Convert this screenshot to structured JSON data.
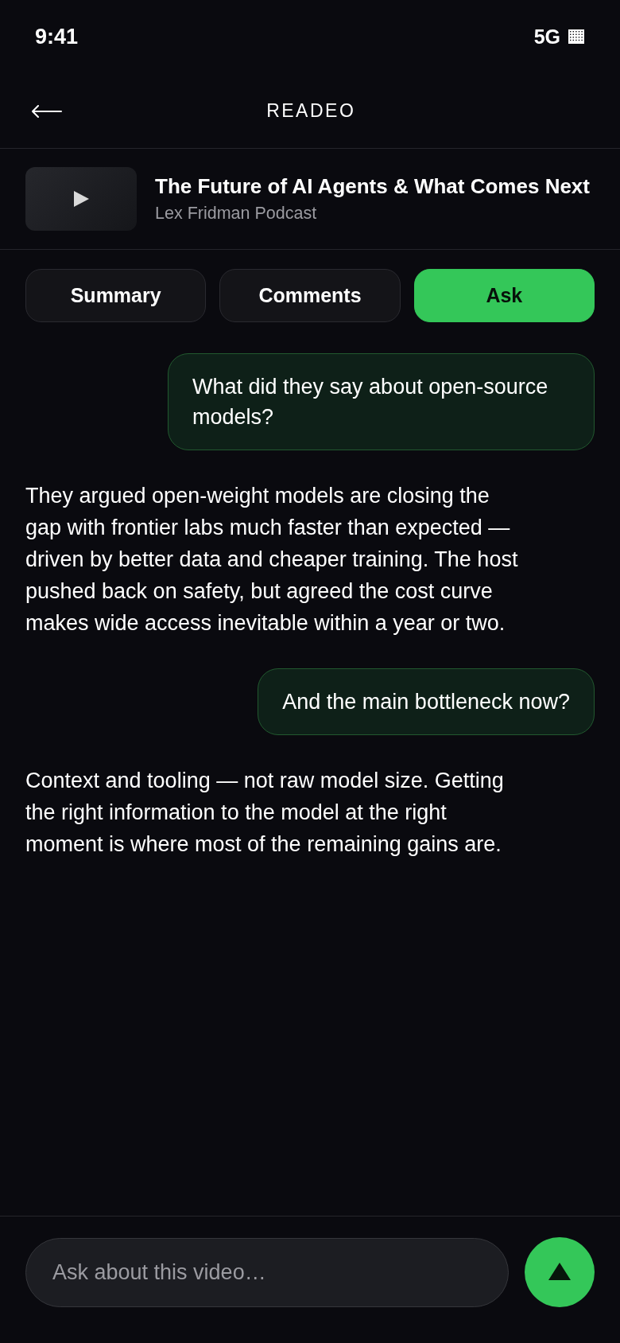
{
  "status_bar": {
    "time": "9:41",
    "network": "5G"
  },
  "header": {
    "title": "READEO"
  },
  "video": {
    "title": "The Future of AI Agents & What Comes Next",
    "channel": "Lex Fridman Podcast"
  },
  "tabs": [
    {
      "label": "Summary",
      "selected": false
    },
    {
      "label": "Comments",
      "selected": false
    },
    {
      "label": "Ask",
      "selected": true
    }
  ],
  "messages": [
    {
      "kind": "question",
      "text": "What did they say about open-source models?"
    },
    {
      "kind": "answer",
      "text": "They argued open-weight models are closing the gap with frontier labs much faster than expected — driven by better data and cheaper training. The host pushed back on safety, but agreed the cost curve makes wide access inevitable within a year or two."
    },
    {
      "kind": "question",
      "text": "And the main bottleneck now?"
    },
    {
      "kind": "answer",
      "text": "Context and tooling — not raw model size. Getting the right information to the model at the right moment is where most of the remaining gains are."
    }
  ],
  "composer": {
    "placeholder": "Ask about this video…"
  }
}
